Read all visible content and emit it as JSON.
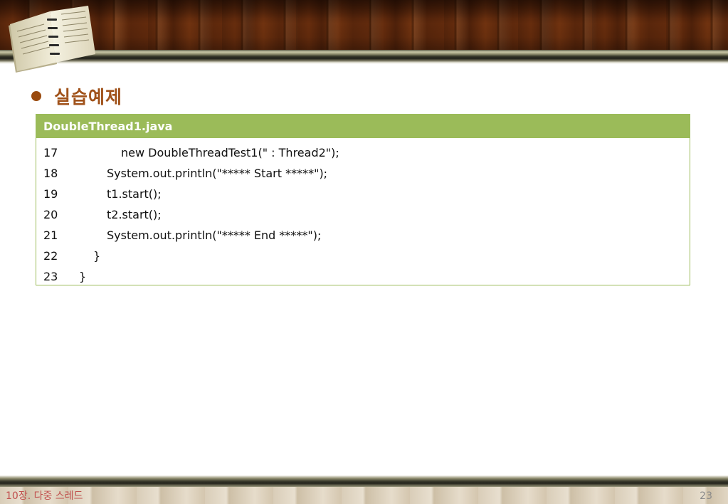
{
  "slide": {
    "title": "실습예제",
    "code_box": {
      "filename": "DoubleThread1.java",
      "lines": [
        {
          "no": "17",
          "code": "new DoubleThreadTest1(\" : Thread2\");",
          "indent": 3
        },
        {
          "no": "18",
          "code": "System.out.println(\"***** Start *****\");",
          "indent": 2
        },
        {
          "no": "19",
          "code": "t1.start();",
          "indent": 2
        },
        {
          "no": "20",
          "code": "t2.start();",
          "indent": 2
        },
        {
          "no": "21",
          "code": "System.out.println(\"***** End *****\");",
          "indent": 2
        },
        {
          "no": "22",
          "code": "}",
          "indent": 1
        },
        {
          "no": "23",
          "code": "}",
          "indent": 0
        }
      ]
    },
    "footer": {
      "chapter": "10장. 다중 스레드",
      "page_number": "23"
    }
  },
  "colors": {
    "title": "#a0521a",
    "bullet": "#9a4a0e",
    "code_header_bg": "#9bbb59",
    "footer_chapter": "#c0504d"
  }
}
